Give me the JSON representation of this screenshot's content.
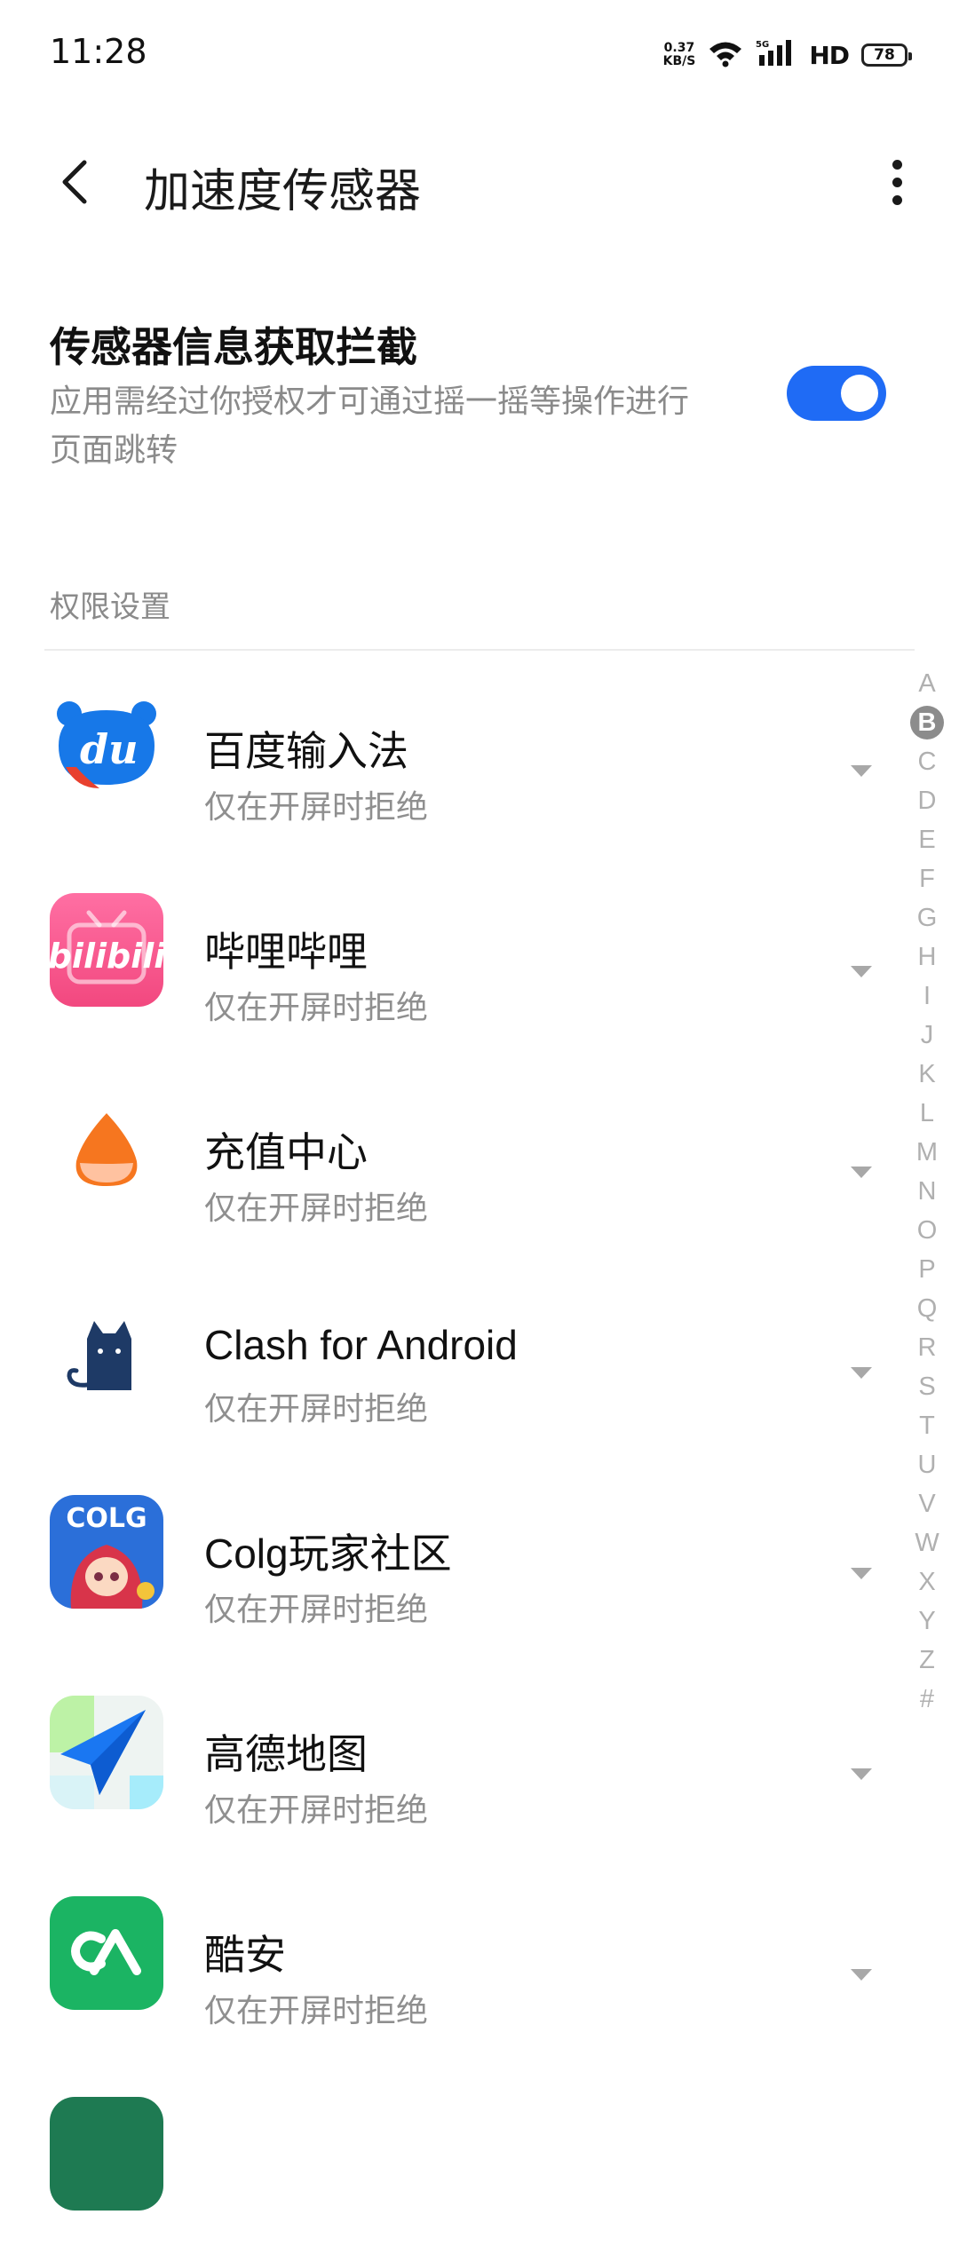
{
  "status_bar": {
    "time": "11:28",
    "net_speed_value": "0.37",
    "net_speed_unit": "KB/S",
    "network_type": "5G",
    "hd": "HD",
    "battery": "78"
  },
  "header": {
    "title": "加速度传感器"
  },
  "sensor_block": {
    "title": "传感器信息获取拦截",
    "description": "应用需经过你授权才可通过摇一摇等操作进行页面跳转",
    "toggle_on": true
  },
  "section_label": "权限设置",
  "apps": [
    {
      "name": "百度输入法",
      "status": "仅在开屏时拒绝",
      "icon": "baidu-input-icon"
    },
    {
      "name": "哔哩哔哩",
      "status": "仅在开屏时拒绝",
      "icon": "bilibili-icon"
    },
    {
      "name": "充值中心",
      "status": "仅在开屏时拒绝",
      "icon": "recharge-center-icon"
    },
    {
      "name": "Clash for Android",
      "status": "仅在开屏时拒绝",
      "icon": "clash-cat-icon"
    },
    {
      "name": "Colg玩家社区",
      "status": "仅在开屏时拒绝",
      "icon": "colg-icon"
    },
    {
      "name": "高德地图",
      "status": "仅在开屏时拒绝",
      "icon": "amap-icon"
    },
    {
      "name": "酷安",
      "status": "仅在开屏时拒绝",
      "icon": "coolapk-icon"
    }
  ],
  "alphabet_index": [
    "A",
    "B",
    "C",
    "D",
    "E",
    "F",
    "G",
    "H",
    "I",
    "J",
    "K",
    "L",
    "M",
    "N",
    "O",
    "P",
    "Q",
    "R",
    "S",
    "T",
    "U",
    "V",
    "W",
    "X",
    "Y",
    "Z",
    "#"
  ],
  "alphabet_active": "B",
  "colors": {
    "accent": "#1f6bf5",
    "secondary_text": "#8a8a8a"
  }
}
